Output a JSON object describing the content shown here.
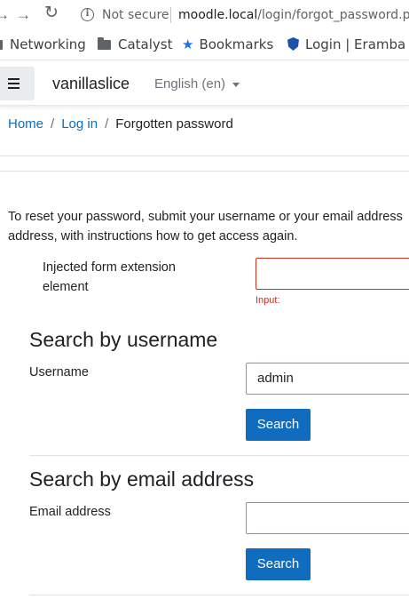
{
  "browser": {
    "security_label": "Not secure",
    "url_host": "moodle.local",
    "url_path": "/login/forgot_password.php"
  },
  "bookmarks": [
    {
      "label": "Networking",
      "icon": "folder-icon"
    },
    {
      "label": "Catalyst",
      "icon": "folder-icon"
    },
    {
      "label": "Bookmarks",
      "icon": "star-icon"
    },
    {
      "label": "Login | Eramba",
      "icon": "shield-icon"
    }
  ],
  "navbar": {
    "site_name": "vanillaslice",
    "language": "English (en)"
  },
  "breadcrumb": {
    "items": [
      "Home",
      "Log in"
    ],
    "current": "Forgotten password"
  },
  "intro": {
    "line1": "To reset your password, submit your username or your email address",
    "line2": "address, with instructions how to get access again."
  },
  "injected": {
    "label_line1": "Injected form extension",
    "label_line2": "element",
    "error_text": "Input:",
    "value": ""
  },
  "username_section": {
    "title": "Search by username",
    "field_label": "Username",
    "value": "admin",
    "button": "Search"
  },
  "email_section": {
    "title": "Search by email address",
    "field_label": "Email address",
    "value": "",
    "button": "Search"
  },
  "colors": {
    "primary": "#0f6cbf",
    "error": "#ca3120",
    "text": "#1d2125"
  }
}
